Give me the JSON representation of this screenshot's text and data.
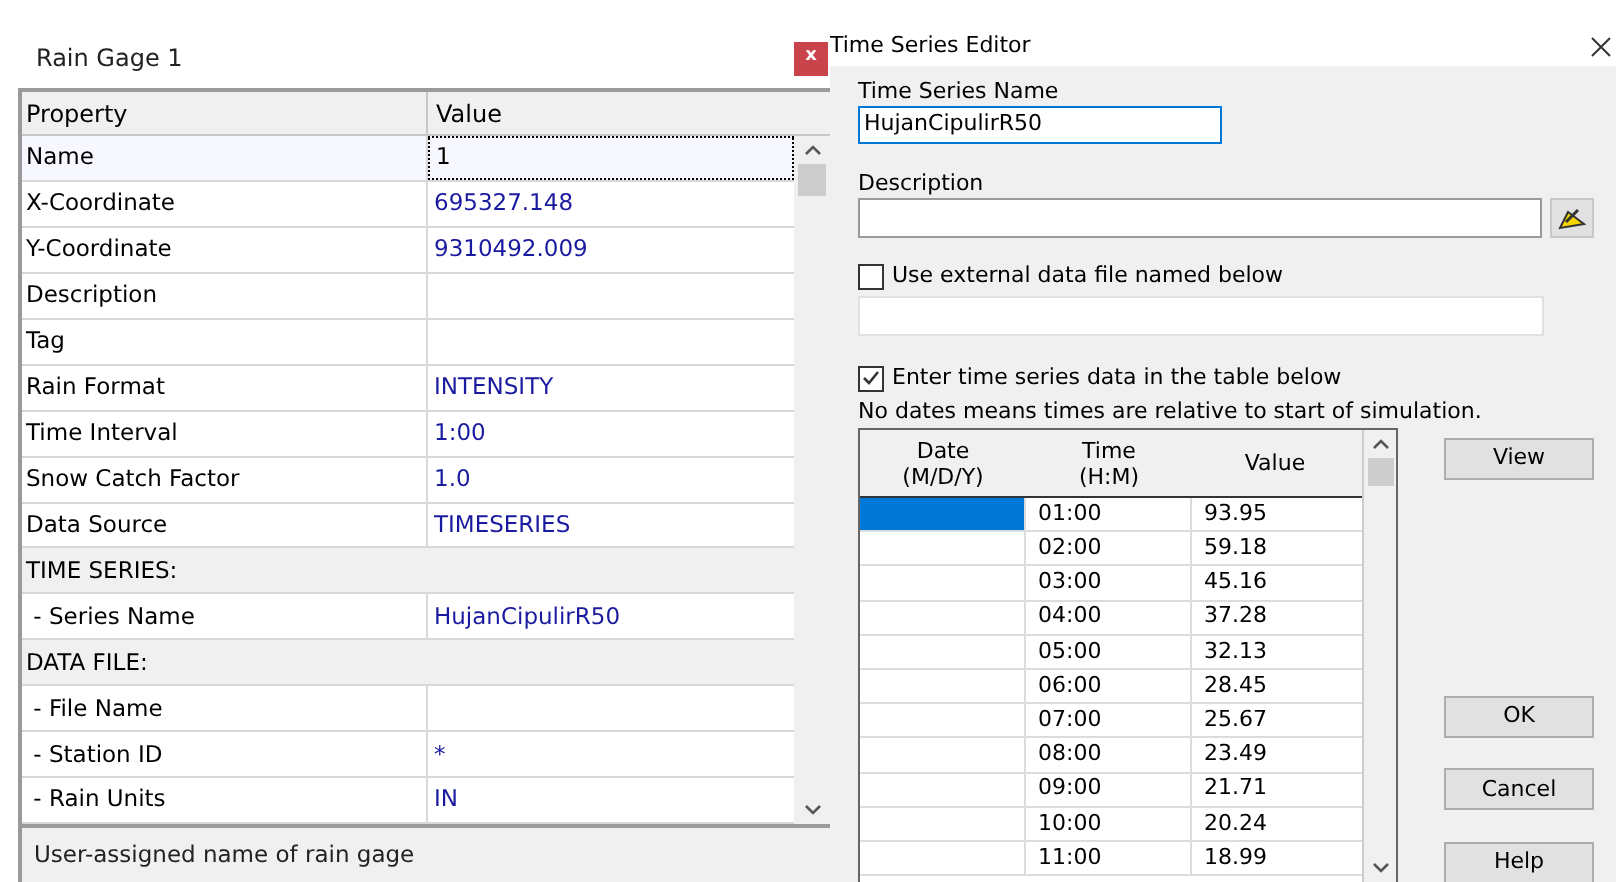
{
  "property_panel": {
    "title": "Rain Gage 1",
    "close": "x",
    "columns": [
      "Property",
      "Value"
    ],
    "rows": [
      {
        "kind": "item",
        "property": "Name",
        "value": "1",
        "focused": true
      },
      {
        "kind": "item",
        "property": "X-Coordinate",
        "value": "695327.148",
        "focused": false
      },
      {
        "kind": "item",
        "property": "Y-Coordinate",
        "value": "9310492.009",
        "focused": false
      },
      {
        "kind": "item",
        "property": "Description",
        "focused": false
      },
      {
        "kind": "item",
        "property": "Tag",
        "focused": false
      },
      {
        "kind": "item",
        "property": "Rain Format",
        "value": "INTENSITY",
        "focused": false
      },
      {
        "kind": "item",
        "property": "Time Interval",
        "value": "1:00",
        "focused": false
      },
      {
        "kind": "item",
        "property": "Snow Catch Factor",
        "value": "1.0",
        "focused": false
      },
      {
        "kind": "item",
        "property": "Data Source",
        "value": "TIMESERIES",
        "focused": false
      },
      {
        "kind": "section",
        "property": "TIME SERIES:"
      },
      {
        "kind": "item",
        "property": " - Series Name",
        "value": "HujanCipulirR50",
        "focused": false
      },
      {
        "kind": "section",
        "property": "DATA FILE:"
      },
      {
        "kind": "item",
        "property": " - File Name",
        "focused": false
      },
      {
        "kind": "item",
        "property": " - Station ID",
        "value": "*",
        "focused": false
      },
      {
        "kind": "item",
        "property": " - Rain Units",
        "value": "IN",
        "focused": false
      }
    ],
    "status": "User-assigned name of rain gage"
  },
  "time_series_editor": {
    "title": "Time Series Editor",
    "name_label": "Time Series Name",
    "name_value": "HujanCipulirR50",
    "description_label": "Description",
    "external_file": {
      "label": "Use external data file named below",
      "checked": false
    },
    "table_entry": {
      "label": "Enter time series data in the table below",
      "checked": true
    },
    "note": "No dates means times are relative to start of simulation.",
    "columns": [
      {
        "line1": "Date",
        "line2": "(M/D/Y)"
      },
      {
        "line1": "Time",
        "line2": "(H:M)"
      },
      {
        "line1": "Value"
      }
    ],
    "rows": [
      {
        "time": "01:00",
        "value": "93.95",
        "selected": true
      },
      {
        "time": "02:00",
        "value": "59.18",
        "selected": false
      },
      {
        "time": "03:00",
        "value": "45.16",
        "selected": false
      },
      {
        "time": "04:00",
        "value": "37.28",
        "selected": false
      },
      {
        "time": "05:00",
        "value": "32.13",
        "selected": false
      },
      {
        "time": "06:00",
        "value": "28.45",
        "selected": false
      },
      {
        "time": "07:00",
        "value": "25.67",
        "selected": false
      },
      {
        "time": "08:00",
        "value": "23.49",
        "selected": false
      },
      {
        "time": "09:00",
        "value": "21.71",
        "selected": false
      },
      {
        "time": "10:00",
        "value": "20.24",
        "selected": false
      },
      {
        "time": "11:00",
        "value": "18.99",
        "selected": false
      }
    ],
    "buttons": {
      "view": "View",
      "ok": "OK",
      "cancel": "Cancel",
      "help": "Help"
    }
  }
}
